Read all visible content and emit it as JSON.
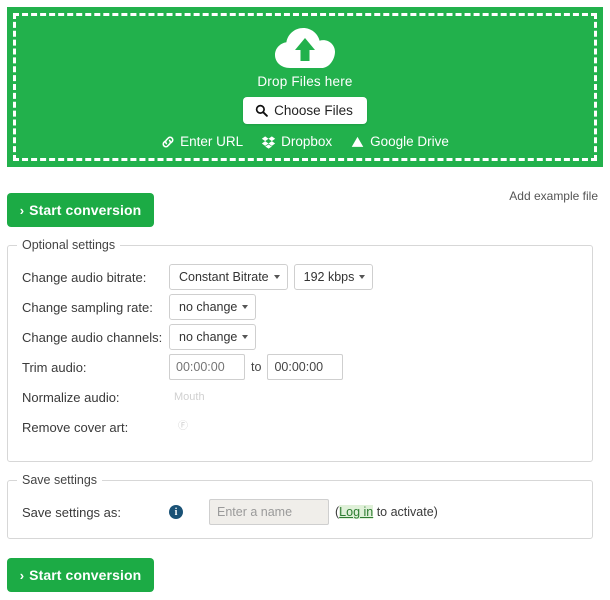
{
  "dropzone": {
    "icon": "cloud-upload-icon",
    "drop_text": "Drop Files here",
    "choose_files_label": "Choose Files",
    "choose_files_icon": "search-icon",
    "accent_color": "#22b14c",
    "sources": [
      {
        "label": "Enter URL",
        "icon": "link-icon"
      },
      {
        "label": "Dropbox",
        "icon": "dropbox-icon"
      },
      {
        "label": "Google Drive",
        "icon": "google-drive-icon"
      }
    ]
  },
  "actions": {
    "start_conversion_label": "Start conversion",
    "start_chevron": "›",
    "add_example_file_label": "Add example file",
    "button_color": "#1cab45"
  },
  "optional_settings": {
    "legend": "Optional settings",
    "rows": {
      "bitrate": {
        "label": "Change audio bitrate:",
        "mode_value": "Constant Bitrate",
        "rate_value": "192 kbps"
      },
      "sampling": {
        "label": "Change sampling rate:",
        "value": "no change"
      },
      "channels": {
        "label": "Change audio channels:",
        "value": "no change"
      },
      "trim": {
        "label": "Trim audio:",
        "from_placeholder": "00:00:00",
        "from_value": "",
        "separator": "to",
        "to_value": "00:00:00"
      },
      "normalize": {
        "label": "Normalize audio:",
        "control_glyph": "Mouth"
      },
      "cover_art": {
        "label": "Remove cover art:",
        "control_glyph": "Ⓕ"
      }
    }
  },
  "save_settings": {
    "legend": "Save settings",
    "label": "Save settings as:",
    "info_icon": "info-icon",
    "info_glyph": "i",
    "name_placeholder": "Enter a name",
    "name_value": "",
    "activate_prefix": "(",
    "login_link": "Log in",
    "activate_suffix": " to activate)"
  }
}
